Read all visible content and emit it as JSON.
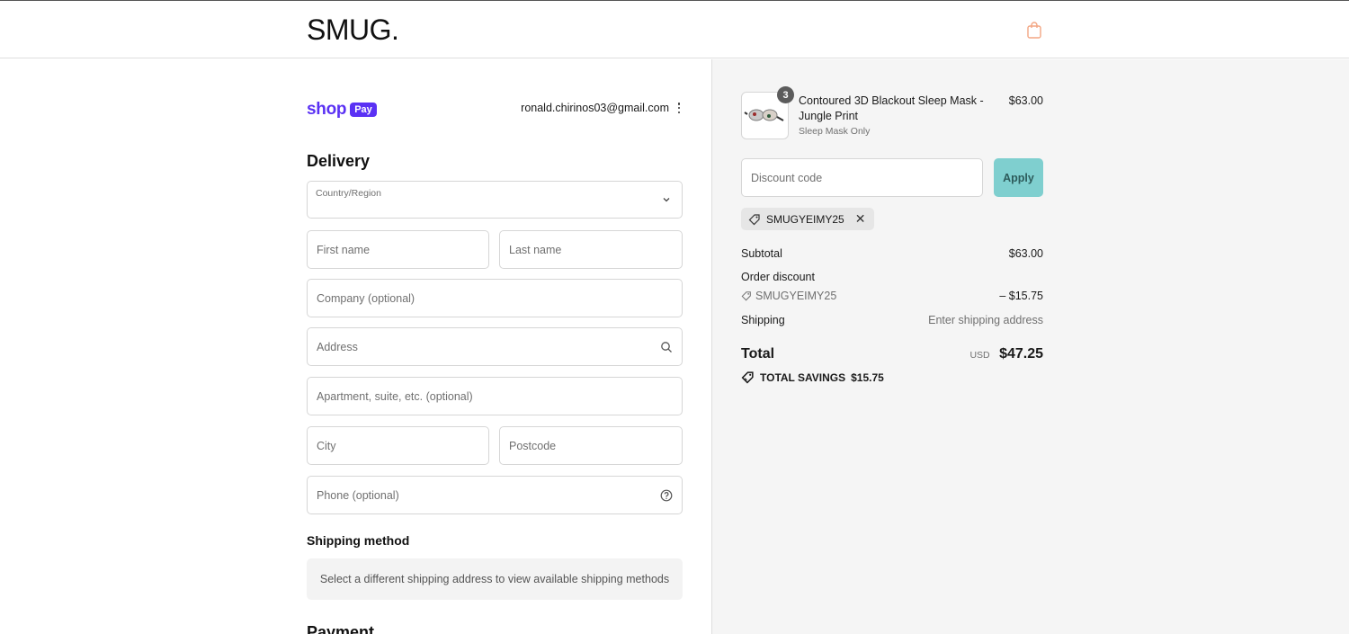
{
  "header": {
    "logo": "SMUG.",
    "cart_icon": "shopping-bag-icon",
    "accent_color": "#f3a683"
  },
  "account": {
    "brand_word": "shop",
    "brand_badge": "Pay",
    "email": "ronald.chirinos03@gmail.com",
    "brand_color": "#5a31f4"
  },
  "delivery": {
    "title": "Delivery",
    "country_label": "Country/Region",
    "first_name_placeholder": "First name",
    "last_name_placeholder": "Last name",
    "company_placeholder": "Company (optional)",
    "address_placeholder": "Address",
    "apartment_placeholder": "Apartment, suite, etc. (optional)",
    "city_placeholder": "City",
    "postcode_placeholder": "Postcode",
    "phone_placeholder": "Phone (optional)"
  },
  "shipping_method": {
    "title": "Shipping method",
    "note": "Select a different shipping address to view available shipping methods"
  },
  "payment": {
    "title": "Payment"
  },
  "summary": {
    "item": {
      "qty": "3",
      "name": "Contoured 3D Blackout Sleep Mask - Jungle Print",
      "variant": "Sleep Mask Only",
      "price": "$63.00"
    },
    "discount_placeholder": "Discount code",
    "apply_label": "Apply",
    "applied_code": "SMUGYEIMY25",
    "subtotal_label": "Subtotal",
    "subtotal_value": "$63.00",
    "order_discount_label": "Order discount",
    "discount_code": "SMUGYEIMY25",
    "discount_value": "– $15.75",
    "shipping_label": "Shipping",
    "shipping_value": "Enter shipping address",
    "total_label": "Total",
    "currency": "USD",
    "total_value": "$47.25",
    "savings_label": "TOTAL SAVINGS",
    "savings_value": "$15.75",
    "apply_color": "#7fcfcf"
  }
}
